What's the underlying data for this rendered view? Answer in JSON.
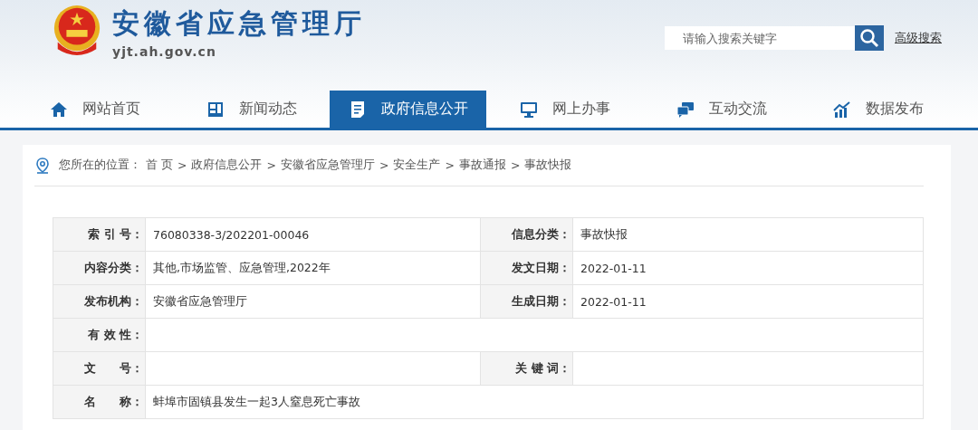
{
  "header": {
    "site_name": "安徽省应急管理厅",
    "domain": "yjt.ah.gov.cn",
    "search": {
      "placeholder": "请输入搜索关键字"
    },
    "advanced_search": "高级搜索"
  },
  "nav": [
    {
      "label": "网站首页",
      "selected": false
    },
    {
      "label": "新闻动态",
      "selected": false
    },
    {
      "label": "政府信息公开",
      "selected": true
    },
    {
      "label": "网上办事",
      "selected": false
    },
    {
      "label": "互动交流",
      "selected": false
    },
    {
      "label": "数据发布",
      "selected": false
    }
  ],
  "breadcrumb": {
    "prefix": "您所在的位置：",
    "separator": ">",
    "items": [
      "首 页",
      "政府信息公开",
      "安徽省应急管理厅",
      "安全生产",
      "事故通报",
      "事故快报"
    ]
  },
  "info_table": {
    "rows": [
      {
        "cells": [
          {
            "label": "索 引 号：",
            "value": "76080338-3/202201-00046"
          },
          {
            "label": "信息分类：",
            "value": "事故快报"
          }
        ]
      },
      {
        "cells": [
          {
            "label": "内容分类：",
            "value": "其他,市场监管、应急管理,2022年"
          },
          {
            "label": "发文日期：",
            "value": "2022-01-11"
          }
        ]
      },
      {
        "cells": [
          {
            "label": "发布机构：",
            "value": "安徽省应急管理厅"
          },
          {
            "label": "生成日期：",
            "value": "2022-01-11"
          }
        ]
      },
      {
        "cells": [
          {
            "label": "有 效 性："
          }
        ]
      },
      {
        "cells": [
          {
            "label": "文　　号："
          },
          {
            "label": "关 键 词："
          }
        ]
      },
      {
        "cells": [
          {
            "label": "名　　称：",
            "value": "蚌埠市固镇县发生一起3人窒息死亡事故"
          }
        ]
      }
    ]
  }
}
